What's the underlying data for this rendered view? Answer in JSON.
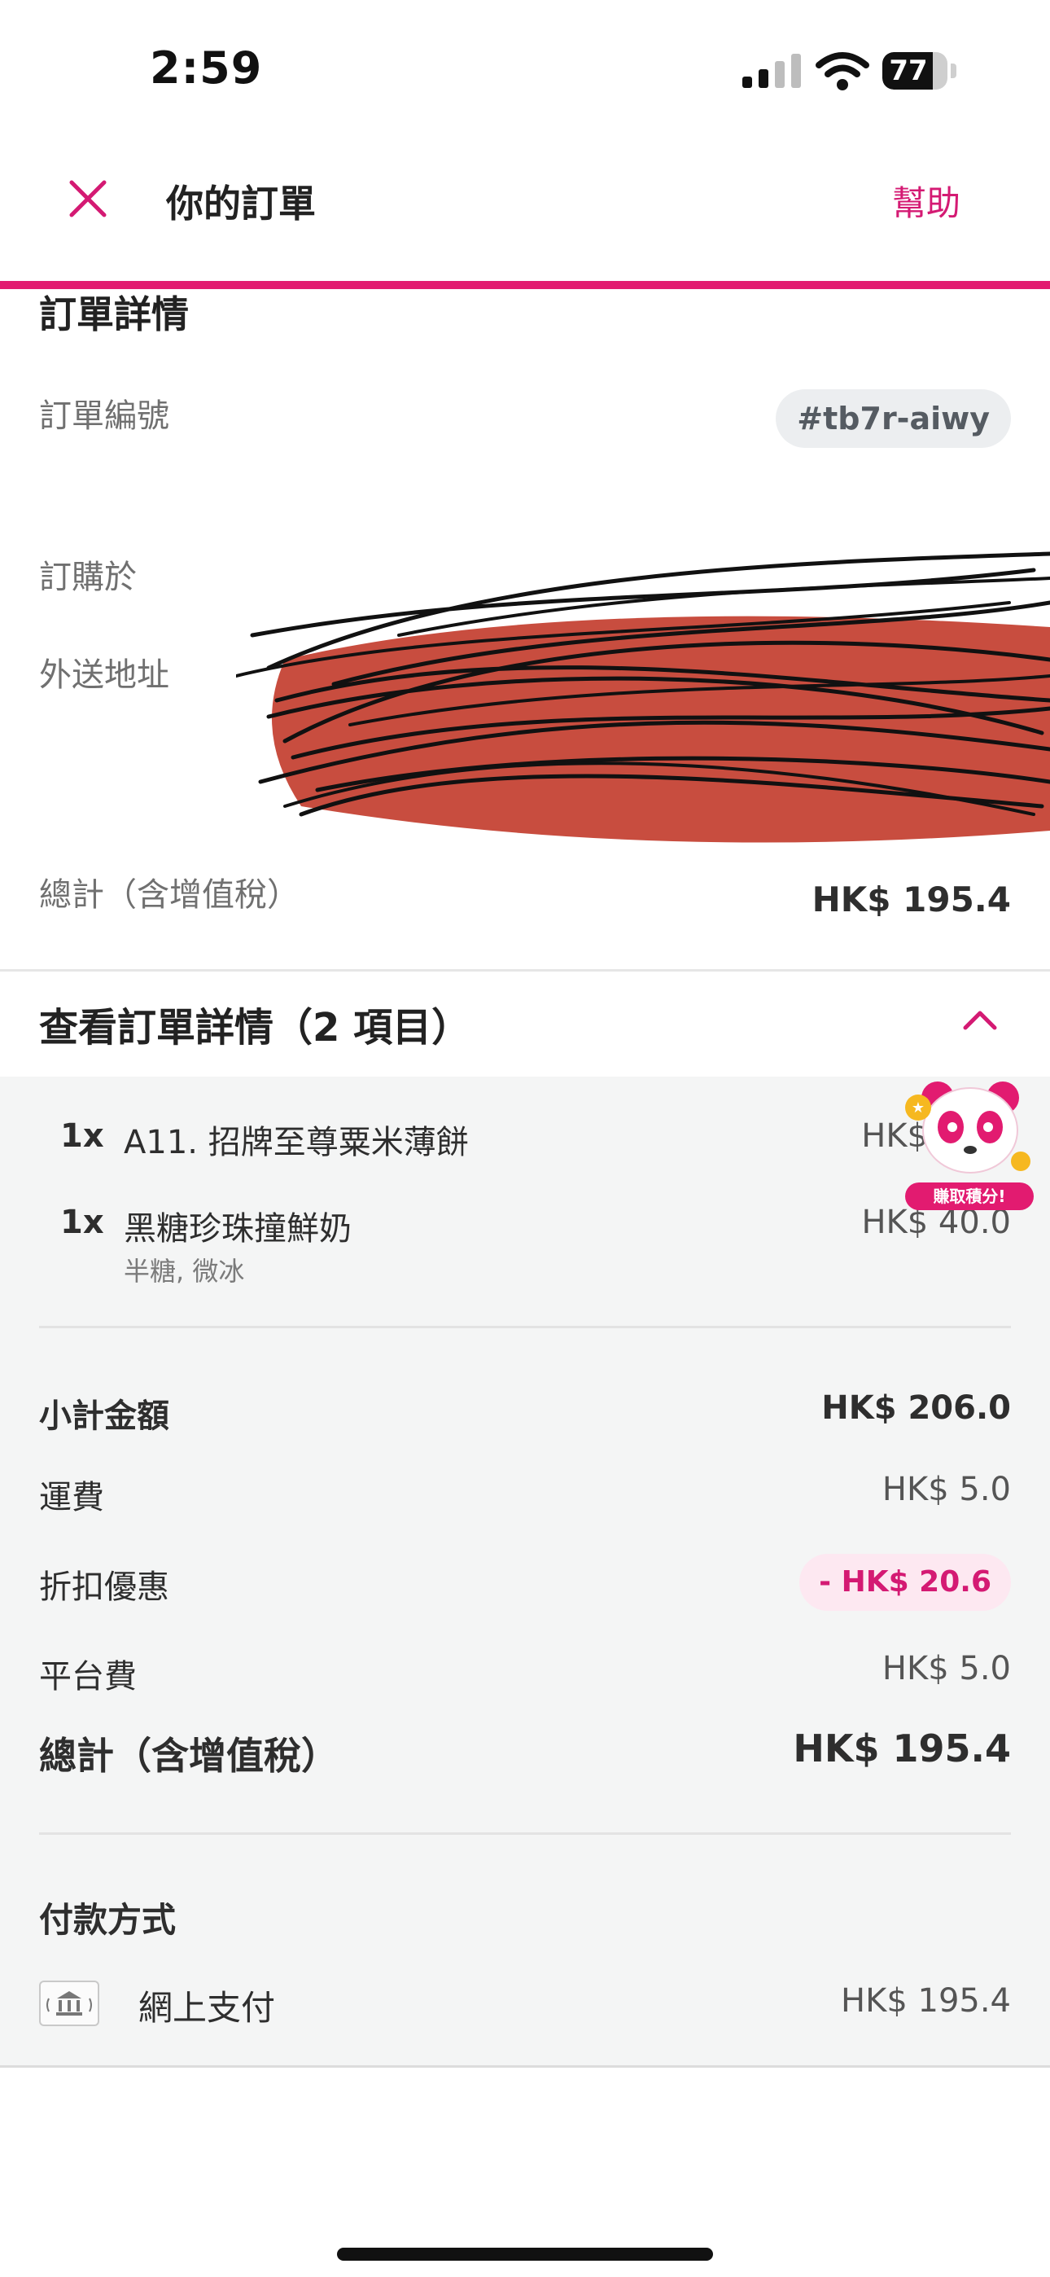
{
  "status_bar": {
    "time": "2:59",
    "battery": "77",
    "battery_fraction": 0.77
  },
  "header": {
    "title": "你的訂單",
    "help": "幫助",
    "progress_fraction": 1.0
  },
  "order_details": {
    "heading": "訂單詳情",
    "order_number_label": "訂單編號",
    "order_number": "#tb7r-aiwy",
    "ordered_from_label": "訂購於",
    "delivery_address_label": "外送地址",
    "total_label": "總計（含增值稅）",
    "total_value": "HK$ 195.4"
  },
  "items_section": {
    "heading": "查看訂單詳情（2 項目）",
    "items": [
      {
        "qty": "1x",
        "name": "A11. 招牌至尊粟米薄餅",
        "price": "HK$",
        "options": ""
      },
      {
        "qty": "1x",
        "name": "黑糖珍珠撞鮮奶",
        "price": "HK$ 40.0",
        "options": "半糖, 微冰"
      }
    ]
  },
  "summary": {
    "subtotal_label": "小計金額",
    "subtotal": "HK$ 206.0",
    "delivery_label": "運費",
    "delivery": "HK$ 5.0",
    "discount_label": "折扣優惠",
    "discount": "- HK$ 20.6",
    "platform_label": "平台費",
    "platform": "HK$ 5.0",
    "total_label": "總計（含增值稅）",
    "total": "HK$ 195.4"
  },
  "payment": {
    "heading": "付款方式",
    "method": "網上支付",
    "amount": "HK$ 195.4",
    "icon": "bank-icon"
  },
  "promo": {
    "tag": "賺取積分!"
  },
  "colors": {
    "brand": "#e21b70",
    "text": "#2e2e2e",
    "muted": "#707070",
    "grey_bg": "#f4f5f5"
  }
}
